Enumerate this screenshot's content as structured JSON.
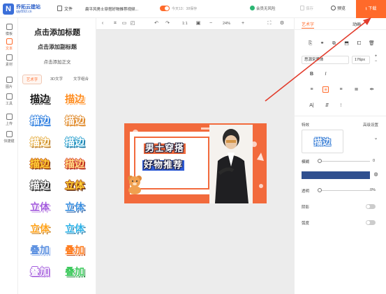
{
  "header": {
    "logo_mark": "N",
    "logo_name": "乔拓云建站",
    "logo_url": "qiyi592.cn",
    "file_label": "文件",
    "doc_title": "扁平风男士穿搭好物推荐视频...",
    "save_note": "今天13：38保存",
    "member_label": "会员无风险",
    "saved_label": "保存",
    "preview_label": "预览",
    "download_label": "下载"
  },
  "rail": {
    "items": [
      {
        "label": "模板",
        "icon": "template-icon"
      },
      {
        "label": "文本",
        "icon": "text-icon"
      },
      {
        "label": "素材",
        "icon": "material-icon"
      },
      {
        "label": "图片",
        "icon": "image-icon"
      },
      {
        "label": "工具",
        "icon": "tool-icon"
      },
      {
        "label": "上传",
        "icon": "upload-icon"
      },
      {
        "label": "快捷键",
        "icon": "shortcut-icon"
      }
    ],
    "active_index": 1
  },
  "text_panel": {
    "add_title": "点击添加标题",
    "add_subtitle": "点击添加副标题",
    "add_body": "点击添加正文",
    "tabs": [
      "艺术字",
      "3D文字",
      "文字组合"
    ],
    "active_tab": 0,
    "styles": [
      {
        "text": "描边",
        "color": "#111111",
        "stroke": "#ffffff",
        "shadow": "#333333"
      },
      {
        "text": "描边",
        "color": "#ff8a1a",
        "stroke": "#ffffff",
        "shadow": "#ffb066"
      },
      {
        "text": "描边",
        "color": "#ffffff",
        "stroke": "#2f7fe0",
        "shadow": "#2f7fe0"
      },
      {
        "text": "描边",
        "color": "#ffffff",
        "stroke": "#e08a2a",
        "shadow": "#e08a2a"
      },
      {
        "text": "描边",
        "color": "#ffffff",
        "stroke": "#e7b14a",
        "shadow": "#b3752a"
      },
      {
        "text": "描边",
        "color": "#ffffff",
        "stroke": "#2fa3d0",
        "shadow": "#1e6f9a"
      },
      {
        "text": "描边",
        "color": "#ffd23a",
        "stroke": "#c45a10",
        "shadow": "#7a3a10"
      },
      {
        "text": "描边",
        "color": "#ffe08a",
        "stroke": "#d8402a",
        "shadow": "#a62a1a"
      },
      {
        "text": "描边",
        "color": "#ffffff",
        "stroke": "#444444",
        "shadow": "#222222"
      },
      {
        "text": "立体",
        "color": "#ffd23a",
        "stroke": "#a64a10",
        "shadow": "#5a2a0a"
      },
      {
        "text": "立体",
        "color": "#a35bdd",
        "stroke": "#ffffff",
        "shadow": "#c99be8"
      },
      {
        "text": "立体",
        "color": "#3a8fe0",
        "stroke": "#ffffff",
        "shadow": "#1e5aa6"
      },
      {
        "text": "立体",
        "color": "#ffa31a",
        "stroke": "#ffffff",
        "shadow": "#c87a10"
      },
      {
        "text": "立体",
        "color": "#2fb3e8",
        "stroke": "#ffffff",
        "shadow": "#1e7aaa"
      },
      {
        "text": "叠加",
        "color": "#5a8fe0",
        "stroke": "#ffffff",
        "shadow": "#9ab8f0"
      },
      {
        "text": "叠加",
        "color": "#ff7a1a",
        "stroke": "#ffffff",
        "shadow": "#c84a10"
      },
      {
        "text": "叠加",
        "color": "#ffffff",
        "stroke": "#a35bdd",
        "shadow": "#c99be8"
      },
      {
        "text": "叠加",
        "color": "#3ac85a",
        "stroke": "#ffffff",
        "shadow": "#1e8a3a"
      }
    ]
  },
  "canvas_toolbar": {
    "ratio": "1:1",
    "zoom": "24%"
  },
  "design": {
    "line1": "男士穿搭",
    "line2": "好物推荐"
  },
  "right_panel": {
    "tabs": [
      "艺术字",
      "动画"
    ],
    "active_tab": 0,
    "font_family": "思源宋黑体",
    "font_size": "176px",
    "effects_label": "特效",
    "advanced_label": "高级设置",
    "effect_preview": "描边",
    "blur_label": "模糊",
    "blur_value": "0",
    "color_hex": "#2f4f8f",
    "opacity_label": "透明",
    "opacity_value": "0%",
    "shadow_label": "阴影",
    "curve_label": "弧度"
  }
}
